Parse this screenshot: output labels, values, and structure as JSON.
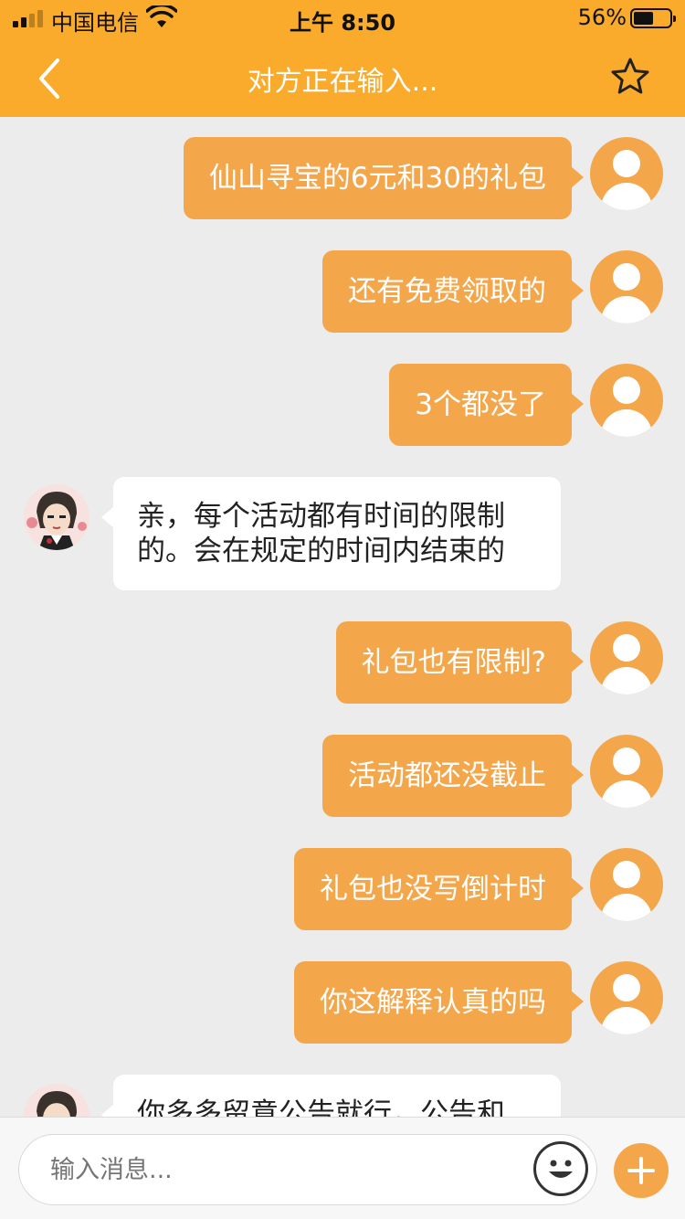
{
  "status_bar": {
    "carrier": "中国电信",
    "time": "上午 8:50",
    "battery_percent": "56%",
    "battery_level": 0.56
  },
  "header": {
    "title": "对方正在输入..."
  },
  "messages": [
    {
      "side": "out",
      "text": "仙山寻宝的6元和30的礼包"
    },
    {
      "side": "out",
      "text": "还有免费领取的"
    },
    {
      "side": "out",
      "text": "3个都没了"
    },
    {
      "side": "in",
      "lines": [
        "亲，每个活动都有时间的限制",
        "的。会在规定的时间内结束的"
      ]
    },
    {
      "side": "out",
      "text": "礼包也有限制?"
    },
    {
      "side": "out",
      "text": "活动都还没截止"
    },
    {
      "side": "out",
      "text": "礼包也没写倒计时"
    },
    {
      "side": "out",
      "text": "你这解释认真的吗"
    },
    {
      "side": "in",
      "lines": [
        "你多多留意公告就行，公告和"
      ]
    }
  ],
  "input": {
    "placeholder": "输入消息..."
  },
  "icons": {
    "back": "chevron-left-icon",
    "favorite": "star-icon",
    "emoji": "smiley-icon",
    "more": "plus-icon"
  },
  "colors": {
    "header": "#fbab2b",
    "bubble_out": "#f4a64a",
    "background": "#ececec"
  }
}
